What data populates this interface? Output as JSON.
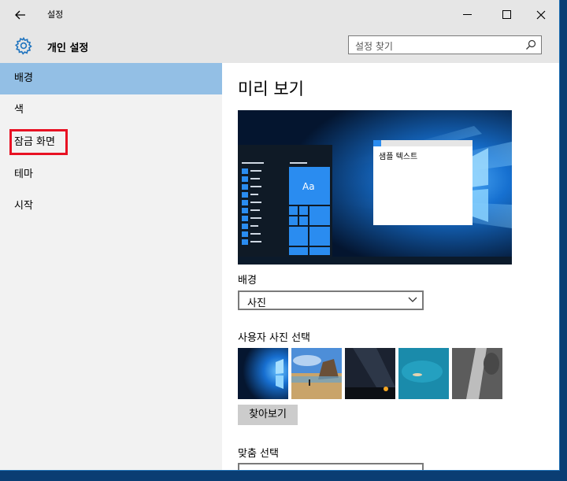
{
  "window": {
    "title": "설정",
    "back_icon": "back-arrow-icon",
    "minimize_glyph": "—",
    "close_glyph": "✕"
  },
  "header": {
    "title": "개인 설정",
    "icon": "gear-icon",
    "search_placeholder": "설정 찾기"
  },
  "sidebar": {
    "items": [
      {
        "label": "배경",
        "active": true
      },
      {
        "label": "색",
        "active": false
      },
      {
        "label": "잠금 화면",
        "active": false,
        "highlighted": true
      },
      {
        "label": "테마",
        "active": false
      },
      {
        "label": "시작",
        "active": false
      }
    ],
    "active_color": "#93bfe5",
    "highlight_color": "#e81123"
  },
  "main": {
    "title": "미리 보기",
    "preview": {
      "sample_text": "샘플 텍스트",
      "tile_text": "Aa"
    },
    "background": {
      "label": "배경",
      "value": "사진"
    },
    "choose_picture": {
      "label": "사용자 사진 선택",
      "thumbnails": [
        "windows-hero",
        "beach-rock",
        "night-sky",
        "underwater",
        "rock-surface"
      ]
    },
    "browse_label": "찾아보기",
    "fit": {
      "label": "맞춤 선택"
    }
  }
}
